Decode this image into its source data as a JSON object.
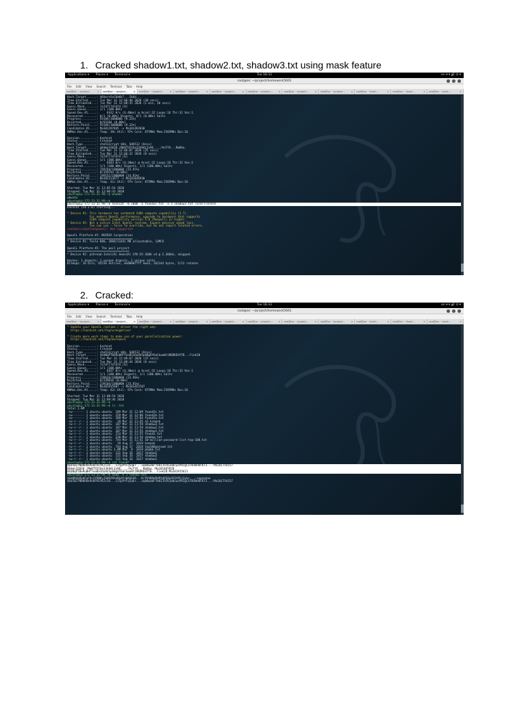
{
  "doc": {
    "item1": {
      "number": "1.",
      "text": "Cracked shadow1.txt, shadow2.txt, shadow3.txt using mask feature"
    },
    "item2": {
      "number": "2.",
      "text": "Cracked:"
    }
  },
  "screen": {
    "topbar": {
      "applications": "Applications ▾",
      "places": "Places ▾",
      "terminal": "Terminal ▾",
      "clock": "Tue 18:33",
      "status": "en ▾  ▾ 🔊 ⏻ ▾"
    },
    "window_title": "root@se: ~/project/homework5601",
    "menu": [
      "File",
      "Edit",
      "View",
      "Search",
      "Terminal",
      "Tabs",
      "Help"
    ],
    "tabs": [
      "root@se: ~/project...",
      "root@se: ~/project...",
      "root@se: ~/project...",
      "root@se: ~/project...",
      "root@se: ~/project...",
      "root@se: ~/project...",
      "root@se: ~/project...",
      "root@se: ~/project...",
      "root@se: ~/hash...",
      "root@se: ~/hash...",
      "root@se: ~/hash..."
    ],
    "tab_close": "×"
  },
  "shot1_lines": [
    {
      "c": "",
      "t": "Hash.Target......: $6$xrvSxC0aKk7...Ik6d..."
    },
    {
      "c": "",
      "t": "Time.Started.....: Tue Mar 31 12:06:46 2020 (30 secs)"
    },
    {
      "c": "",
      "t": "Time.Estimated...: Tue Mar 31 12:08:35 2020 (1 min, 20 secs)"
    },
    {
      "c": "",
      "t": "Guess.Mask.......: ?a?d?l?d?d?d [6]"
    },
    {
      "c": "",
      "t": "Guess.Queue......: 1/1 (100.00%)"
    },
    {
      "c": "",
      "t": "Speed.Dev.#1.....:     6432 H/s (6.40ms) @ Accel:32 Loops:16 Thr:32 Vec:1"
    },
    {
      "c": "",
      "t": "Recovered........: 0/1 (0.00%) Digests, 0/1 (0.00%) Salts"
    },
    {
      "c": "",
      "t": "Progress.........: 93184/1000000 (9.32%)"
    },
    {
      "c": "",
      "t": "Rejected.........: 0/93184 (0.00%)"
    },
    {
      "c": "",
      "t": "Restore.Point....: 93184/1000000 (9.32%)"
    },
    {
      "c": "",
      "t": "Candidates.#1....: Ma101297845 -> Ma101492830"
    },
    {
      "c": "",
      "t": "HWMon.Dev.#1.....: Temp: 39c Util: 97% Core: 875MHz Mem:2505MHz Bus:16"
    },
    {
      "c": "",
      "t": " "
    },
    {
      "c": "",
      "t": "Session..........: hashcat"
    },
    {
      "c": "",
      "t": "Status...........: Cracked"
    },
    {
      "c": "",
      "t": "Hash.Type........: sha512crypt $6$, SHA512 (Unix)"
    },
    {
      "c": "",
      "t": "Hash.Target......: $6$mn32028.|Mm0TS5fGe3Jk9dLIx96..../AcFYX...Rm0ha."
    },
    {
      "c": "",
      "t": "Time.Started.....: Tue Mar 31 12:06:07 2020 (25 secs)"
    },
    {
      "c": "",
      "t": "Time.Estimated...: Tue Mar 31 12:06:32 2020 (0 secs)"
    },
    {
      "c": "",
      "t": "Guess.Mask.......: ?a?d?l?d?d?d [6]"
    },
    {
      "c": "",
      "t": "Guess.Queue......: 1/1 (100.00%)"
    },
    {
      "c": "",
      "t": "Speed.Dev.#1.....:     6444 H/s (6.20ms) @ Accel:32 Loops:16 Thr:32 Vec:1"
    },
    {
      "c": "",
      "t": "Recovered........: 1/1 (100.00%) Digests, 1/1 (100.00%) Salts"
    },
    {
      "c": "",
      "t": "Progress.........: 159744/1000000 (15.97%)"
    },
    {
      "c": "",
      "t": "Rejected.........: 0/159744 (0.00%)"
    },
    {
      "c": "",
      "t": "Restore.Point....: 149152/1000000 (14.92%)"
    },
    {
      "c": "",
      "t": "Candidates.#1....: Ma101113677 -> Ma101036938"
    },
    {
      "c": "",
      "t": "HWMon.Dev.#1.....: Temp: 41c Util: 97% Core: 875MHz Mem:2505MHz Bus:16"
    },
    {
      "c": "",
      "t": " "
    },
    {
      "c": "",
      "t": "Started: Tue Mar 31 12:05:54 2020"
    },
    {
      "c": "",
      "t": "Stopped: Tue Mar 31 12:06:33 2020"
    },
    {
      "c": "g",
      "t": "ubuntu@ip-172-31-31-99:~$ whoami"
    },
    {
      "c": "",
      "t": "ubuntu"
    },
    {
      "c": "g",
      "t": "ubuntu@ip-172-31-31-99:~$"
    },
    {
      "c": "hl",
      "t": "ubuntu@ip-172-31-31-99:~$ hashcat -m 1800 -o found3c.txt -a 3 shadow3.txt ?a?d?l?d?d?d"
    },
    {
      "c": "",
      "t": "hashcat (v4.1.0) starting..."
    },
    {
      "c": "",
      "t": " "
    },
    {
      "c": "y",
      "t": "* Device #1: This hardware has outdated CUDA compute capability (3.7)."
    },
    {
      "c": "y",
      "t": "             For modern OpenCL performance, upgrade to hardware that supports"
    },
    {
      "c": "y",
      "t": "             CUDA compute capability version 5.0 (Maxwell) or higher."
    },
    {
      "c": "y",
      "t": "* Device #2: Not a native Intel OpenCL runtime. Expect massive speed loss."
    },
    {
      "c": "y",
      "t": "             You can use --force to override, but do not report related errors."
    },
    {
      "c": "rd",
      "t": "nvmlDeviceGetFanSpeed(): Not Supported"
    },
    {
      "c": "",
      "t": " "
    },
    {
      "c": "",
      "t": "OpenCL Platform #1: NVIDIA Corporation"
    },
    {
      "c": "",
      "t": "======================================"
    },
    {
      "c": "",
      "t": "* Device #1: Tesla K80, 2868/11441 MB allocatable, 13MCU"
    },
    {
      "c": "",
      "t": " "
    },
    {
      "c": "",
      "t": "OpenCL Platform #2: The pocl project"
    },
    {
      "c": "",
      "t": "===================================="
    },
    {
      "c": "",
      "t": "* Device #2: pthread-Intel(R) Xeon(R) CPU E5-2686 v4 @ 2.30GHz, skipped."
    },
    {
      "c": "",
      "t": " "
    },
    {
      "c": "",
      "t": "Hashes: 1 digests; 1 unique digests, 1 unique salts"
    },
    {
      "c": "",
      "t": "Bitmaps: 16 bits, 65536 entries, 0x0000ffff mask, 262144 bytes, 5/13 rotates"
    }
  ],
  "shot2_lines": [
    {
      "c": "y",
      "t": "* Update your OpenCL runtime / driver the right way:"
    },
    {
      "c": "y",
      "t": "  https://hashcat.net/faq/wrongdriver"
    },
    {
      "c": "",
      "t": " "
    },
    {
      "c": "y",
      "t": "* Create more work items to make use of your parallelization power:"
    },
    {
      "c": "y",
      "t": "  https://hashcat.net/faq/morework"
    },
    {
      "c": "",
      "t": " "
    },
    {
      "c": "",
      "t": "Session..........: hashcat"
    },
    {
      "c": "",
      "t": "Status...........: Cracked"
    },
    {
      "c": "",
      "t": "Hash.Type........: sha512crypt $6$, SHA512 (Unix)"
    },
    {
      "c": "",
      "t": "Hash.Target......: $6$NqPTBeRu0HfYoeBS3OaXb5pbBgVY6aCkaa0t1RKDKEUYTB...Fiek20"
    },
    {
      "c": "",
      "t": "Time.Started.....: Tue Mar 31 12:09:07 2020 (37 secs)"
    },
    {
      "c": "",
      "t": "Time.Estimated...: Tue Mar 31 12:09:44 2020 (0 secs)"
    },
    {
      "c": "",
      "t": "Guess.Mask.......: ?a?d?l?d?d?d [6]"
    },
    {
      "c": "",
      "t": "Guess.Queue......: 1/1 (100.00%)"
    },
    {
      "c": "",
      "t": "Speed.Dev.#1.....:     6437 H/s (6.30ms) @ Accel:32 Loops:16 Thr:32 Vec:1"
    },
    {
      "c": "",
      "t": "Recovered........: 1/1 (100.00%) Digests, 1/1 (100.00%) Salts"
    },
    {
      "c": "",
      "t": "Progress.........: 239616/1000000 (23.96%)"
    },
    {
      "c": "",
      "t": "Rejected.........: 0/239616 (0.00%)"
    },
    {
      "c": "",
      "t": "Restore.Point....: 239104/1000000 (23.91%)"
    },
    {
      "c": "",
      "t": "Candidates.#1....: Ma101915607 -> Ma101453707"
    },
    {
      "c": "",
      "t": "HWMon.Dev.#1.....: Temp: 42c Util: 97% Core: 875MHz Mem:2505MHz Bus:16"
    },
    {
      "c": "",
      "t": " "
    },
    {
      "c": "",
      "t": "Started: Tue Mar 31 12:08:54 2020"
    },
    {
      "c": "",
      "t": "Stopped: Tue Mar 31 12:09:46 2020"
    },
    {
      "c": "g",
      "t": "ubuntu@ip-172-31-31-99:~$"
    },
    {
      "c": "g",
      "t": "ubuntu@ip-172-31-31-99:~$ ls -lht"
    },
    {
      "c": "",
      "t": "total 1.0M"
    },
    {
      "c": "",
      "t": "-rw------- 1 ubuntu ubuntu  189 Mar 31 12:09 found3c.txt"
    },
    {
      "c": "",
      "t": "-rw------- 1 ubuntu ubuntu  159 Mar 31 12:06 found2b.txt"
    },
    {
      "c": "",
      "t": "-rw------- 1 ubuntu ubuntu  189 Mar 31 12:04 found1a.txt"
    },
    {
      "c": "",
      "t": "-rw-r--r-- 1 ubuntu ubuntu   19 Mar 31 11:45 a2.hcmask"
    },
    {
      "c": "",
      "t": "-rw-r--r-- 1 ubuntu ubuntu  107 Mar 31 11:59 shadow3.txt"
    },
    {
      "c": "",
      "t": "-rw-r--r-- 1 ubuntu ubuntu  107 Mar 31 11:59 shadow2.txt"
    },
    {
      "c": "",
      "t": "-rw-r--r-- 1 ubuntu ubuntu  107 Mar 31 11:55 shadow1.txt"
    },
    {
      "c": "",
      "t": "-rw-r--r-- 1 ubuntu ubuntu  214 Mar 31 11:55 found1.txt"
    },
    {
      "c": "",
      "t": "-rw-r--r-- 1 ubuntu ubuntu  230 Mar 31 11:54 shadow.txt"
    },
    {
      "c": "",
      "t": "-rw-r--r-- 1 ubuntu ubuntu  744 Mar 31 11:41 10-million-password-list-top-100.txt"
    },
    {
      "c": "",
      "t": "-rw-r--r-- 1 ubuntu ubuntu   19 Aug 17  2019 hcmask"
    },
    {
      "c": "",
      "t": "-rw-r--r-- 1 ubuntu ubuntu  744 Aug 17  2019 top100passwd.txt"
    },
    {
      "c": "",
      "t": "-rw-r--r-- 1 ubuntu ubuntu 1.0M Mar  8  2019 phpbb.txt"
    },
    {
      "c": "",
      "t": "-rw-r--r-- 1 ubuntu ubuntu  131 Sep 16  2017 shadow2"
    },
    {
      "c": "",
      "t": "-rw-r--r-- 1 ubuntu ubuntu  131 Sep 16  2017 shadow3"
    },
    {
      "c": "",
      "t": "-rw-r--r-- 1 ubuntu ubuntu  131 Sep 16  2017 shadow1"
    },
    {
      "c": "g",
      "t": "ubuntu@ip-172-31-31-99:~$ cat found*"
    },
    {
      "c": "hl",
      "t": "$6$5027N0KRUk9e0FH1tK2s3d...sJ5pPtFq5q6r...vqb8wuWr7bHIJ5FK3a0cwcPRJgCoTH2WnKFKT3...:Ma101754157"
    },
    {
      "c": "hl",
      "t": "$6$mn32028.|Mm0TS5fGe3Jk9dLIx96..../AcFYX...Rm0ha.:Ma101465920"
    },
    {
      "c": "hl",
      "t": "$6$NqPTBeRu0HfYoeBS3OaXb5pbBgVY6aCkaa0t1RKDKEUYTB...Fiek20:Ma101915621"
    },
    {
      "c": "g",
      "t": "ubuntu@ip-172-31-31-99:~$ head -n 1 found1.txt"
    },
    {
      "c": "",
      "t": "$6$BRXm9pHFaFVuIfDB8yIS8OZ9XaRGdYsW4GEkR...Kr9YhB9pMzMtdPS8eXFQtPCs3ykc...:superman"
    },
    {
      "c": "",
      "t": "$6$5027N0KRUk9e0FH1tK2s3d...sJ5pPtFq5q6r...vqb8wuWr7bHIJ5FK3a0cwcPRJgCoTH2WnKFKT3...:Ma101754157"
    }
  ]
}
